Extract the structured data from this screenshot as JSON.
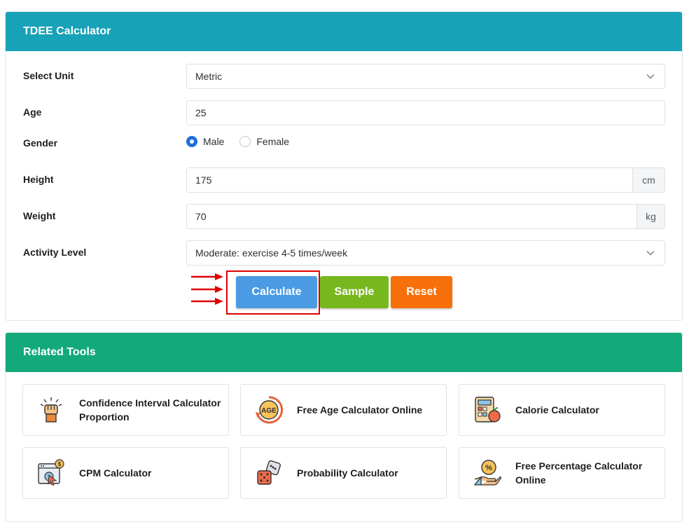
{
  "calculator": {
    "title": "TDEE Calculator",
    "unit_label": "Select Unit",
    "unit_value": "Metric",
    "age_label": "Age",
    "age_value": "25",
    "gender_label": "Gender",
    "gender_options": [
      "Male",
      "Female"
    ],
    "gender_selected": "Male",
    "height_label": "Height",
    "height_value": "175",
    "height_unit": "cm",
    "weight_label": "Weight",
    "weight_value": "70",
    "weight_unit": "kg",
    "activity_label": "Activity Level",
    "activity_value": "Moderate: exercise 4-5 times/week",
    "buttons": {
      "calculate": "Calculate",
      "sample": "Sample",
      "reset": "Reset"
    }
  },
  "colors": {
    "calc_header": "#17a2b8",
    "tools_header": "#13a97b",
    "calculate": "#4a9be3",
    "sample": "#79b71f",
    "reset": "#f7700a",
    "highlight": "#e00000"
  },
  "related": {
    "title": "Related Tools",
    "items": [
      {
        "label": "Confidence Interval Calculator Proportion",
        "icon": "raised-fist-icon"
      },
      {
        "label": "Free Age Calculator Online",
        "icon": "age-badge-icon"
      },
      {
        "label": "Calorie Calculator",
        "icon": "calculator-apple-icon"
      },
      {
        "label": "CPM Calculator",
        "icon": "browser-click-dollar-icon"
      },
      {
        "label": "Probability Calculator",
        "icon": "dice-icon"
      },
      {
        "label": "Free Percentage Calculator Online",
        "icon": "hand-percent-icon"
      }
    ]
  }
}
